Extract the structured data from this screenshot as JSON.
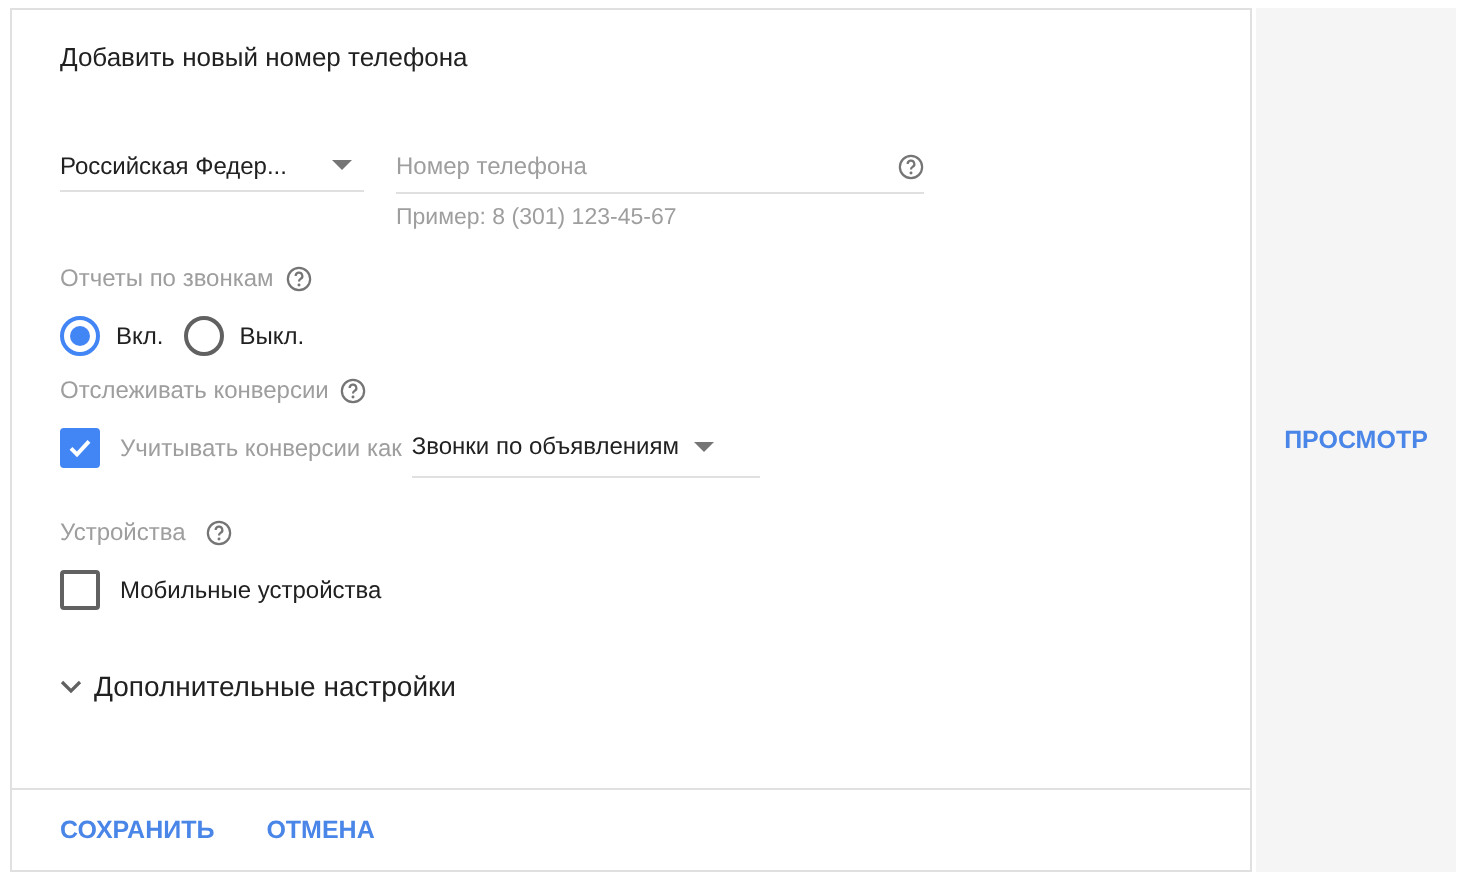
{
  "dialog": {
    "title": "Добавить новый номер телефона",
    "country_select": {
      "value": "Российская Федер..."
    },
    "phone_field": {
      "placeholder": "Номер телефона",
      "hint": "Пример: 8 (301) 123-45-67"
    },
    "call_reports": {
      "label": "Отчеты по звонкам",
      "options": [
        {
          "label": "Вкл.",
          "selected": true
        },
        {
          "label": "Выкл.",
          "selected": false
        }
      ]
    },
    "conversions": {
      "label": "Отслеживать конверсии",
      "checkbox": {
        "label": "Учитывать конверсии как",
        "checked": true
      },
      "select": {
        "value": "Звонки по объявлениям"
      }
    },
    "devices": {
      "label": "Устройства",
      "checkbox": {
        "label": "Мобильные устройства",
        "checked": false
      }
    },
    "advanced": {
      "label": "Дополнительные настройки",
      "expanded": false
    },
    "buttons": [
      "СОХРАНИТЬ",
      "ОТМЕНА"
    ]
  },
  "preview_button": "ПРОСМОТР"
}
